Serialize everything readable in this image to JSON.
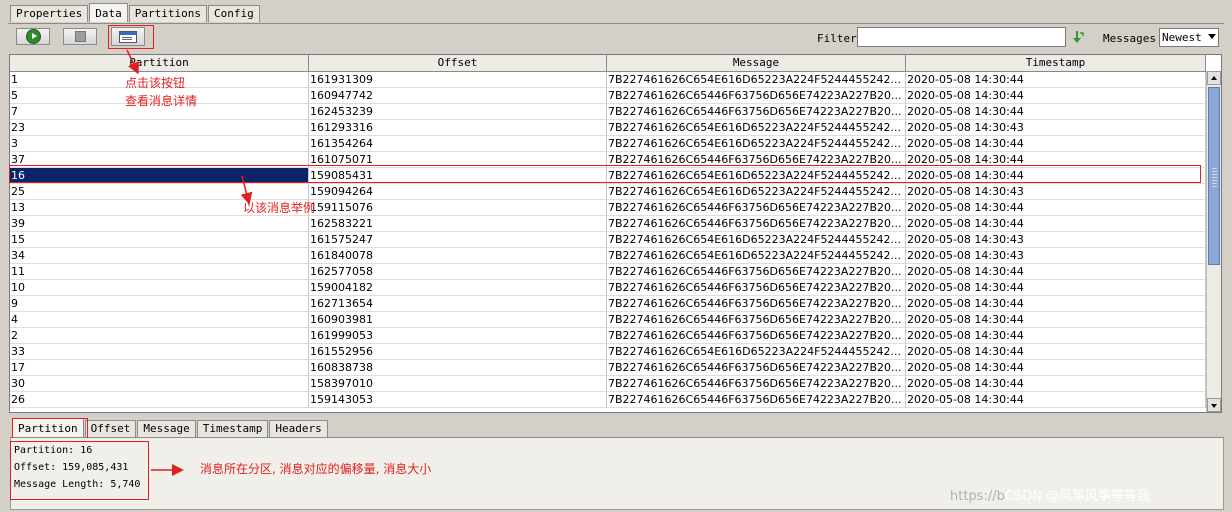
{
  "top_tabs": [
    "Properties",
    "Data",
    "Partitions",
    "Config"
  ],
  "active_top_tab": "Data",
  "toolbar": {
    "start_icon": "play-icon",
    "stop_icon": "stop-icon",
    "view_icon": "view-message-icon",
    "filter_label": "Filter",
    "filter_value": "",
    "refresh_icon": "green-down-arrow-icon",
    "messages_label": "Messages",
    "messages_select": "Newest"
  },
  "table": {
    "columns": [
      "Partition",
      "Offset",
      "Message",
      "Timestamp"
    ],
    "selected_partition": "16",
    "rows": [
      [
        "1",
        "161931309",
        "7B227461626C654E616D65223A224F5244455242...",
        "2020-05-08 14:30:44"
      ],
      [
        "5",
        "160947742",
        "7B227461626C65446F63756D656E74223A227B20...",
        "2020-05-08 14:30:44"
      ],
      [
        "7",
        "162453239",
        "7B227461626C65446F63756D656E74223A227B20...",
        "2020-05-08 14:30:44"
      ],
      [
        "23",
        "161293316",
        "7B227461626C654E616D65223A224F5244455242...",
        "2020-05-08 14:30:43"
      ],
      [
        "3",
        "161354264",
        "7B227461626C654E616D65223A224F5244455242...",
        "2020-05-08 14:30:44"
      ],
      [
        "37",
        "161075071",
        "7B227461626C65446F63756D656E74223A227B20...",
        "2020-05-08 14:30:44"
      ],
      [
        "16",
        "159085431",
        "7B227461626C654E616D65223A224F5244455242...",
        "2020-05-08 14:30:44"
      ],
      [
        "25",
        "159094264",
        "7B227461626C654E616D65223A224F5244455242...",
        "2020-05-08 14:30:43"
      ],
      [
        "13",
        "159115076",
        "7B227461626C65446F63756D656E74223A227B20...",
        "2020-05-08 14:30:44"
      ],
      [
        "39",
        "162583221",
        "7B227461626C65446F63756D656E74223A227B20...",
        "2020-05-08 14:30:44"
      ],
      [
        "15",
        "161575247",
        "7B227461626C654E616D65223A224F5244455242...",
        "2020-05-08 14:30:43"
      ],
      [
        "34",
        "161840078",
        "7B227461626C654E616D65223A224F5244455242...",
        "2020-05-08 14:30:43"
      ],
      [
        "11",
        "162577058",
        "7B227461626C65446F63756D656E74223A227B20...",
        "2020-05-08 14:30:44"
      ],
      [
        "10",
        "159004182",
        "7B227461626C65446F63756D656E74223A227B20...",
        "2020-05-08 14:30:44"
      ],
      [
        "9",
        "162713654",
        "7B227461626C65446F63756D656E74223A227B20...",
        "2020-05-08 14:30:44"
      ],
      [
        "4",
        "160903981",
        "7B227461626C65446F63756D656E74223A227B20...",
        "2020-05-08 14:30:44"
      ],
      [
        "2",
        "161999053",
        "7B227461626C65446F63756D656E74223A227B20...",
        "2020-05-08 14:30:44"
      ],
      [
        "33",
        "161552956",
        "7B227461626C654E616D65223A224F5244455242...",
        "2020-05-08 14:30:44"
      ],
      [
        "17",
        "160838738",
        "7B227461626C65446F63756D656E74223A227B20...",
        "2020-05-08 14:30:44"
      ],
      [
        "30",
        "158397010",
        "7B227461626C65446F63756D656E74223A227B20...",
        "2020-05-08 14:30:44"
      ],
      [
        "26",
        "159143053",
        "7B227461626C65446F63756D656E74223A227B20...",
        "2020-05-08 14:30:44"
      ]
    ]
  },
  "bottom_tabs": [
    "Partition",
    "Offset",
    "Message",
    "Timestamp",
    "Headers"
  ],
  "active_bottom_tab": "Partition",
  "detail": {
    "partition_line": "Partition: 16",
    "offset_line": "Offset: 159,085,431",
    "length_line": "Message Length: 5,740"
  },
  "annotations": {
    "button_note_1": "点击该按钮",
    "button_note_2": "查看消息详情",
    "row_note": "以该消息举例",
    "detail_note": "消息所在分区, 消息对应的偏移量, 消息大小",
    "color": "#e02020"
  },
  "watermark": {
    "prefix": "https://b",
    "text": "CSDN @风筝风筝等等我"
  }
}
